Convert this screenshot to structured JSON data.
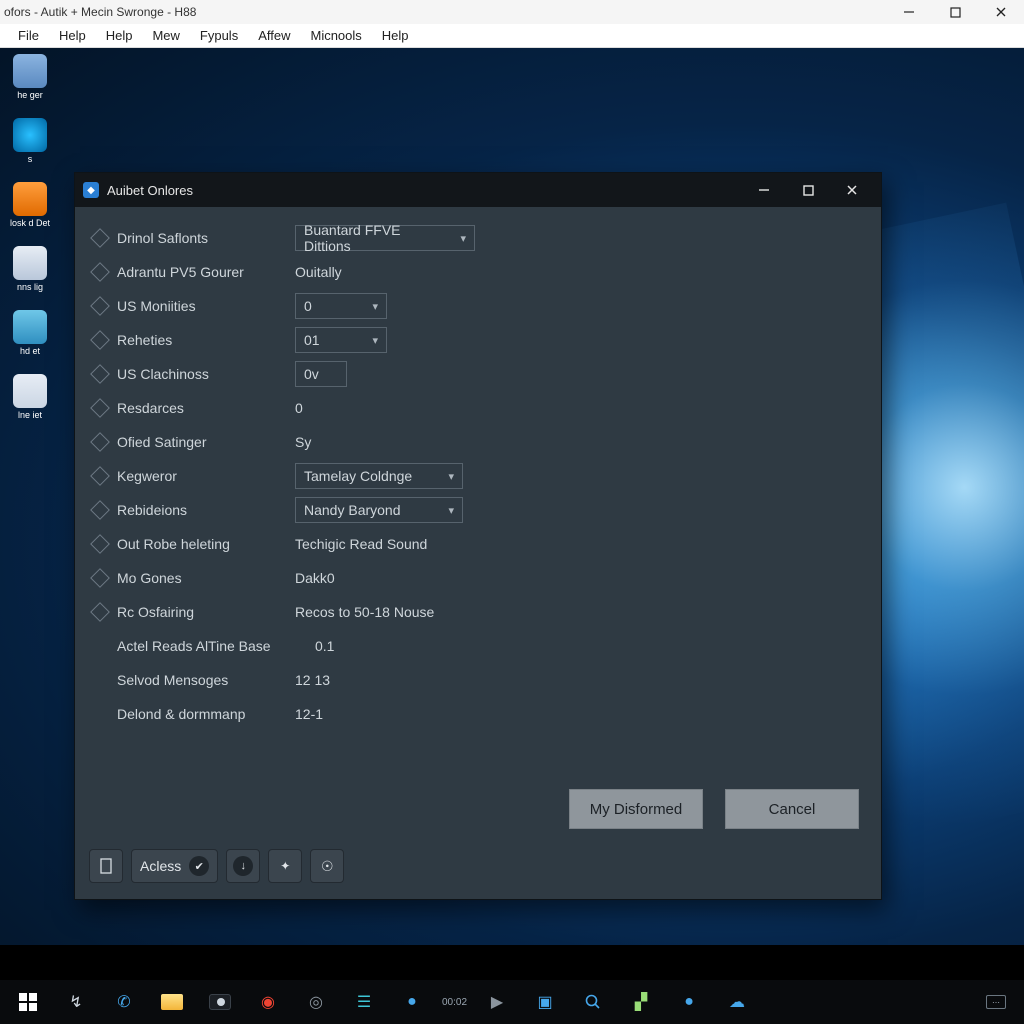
{
  "app": {
    "title": "ofors - Autik + Mecin Swronge - H88"
  },
  "menubar": [
    "File",
    "Help",
    "Help",
    "Mew",
    "Fypuls",
    "Affew",
    "Micnools",
    "Help"
  ],
  "desktop_icons": [
    {
      "label": "he\nger"
    },
    {
      "label": "s"
    },
    {
      "label": "losk\nd Det"
    },
    {
      "label": "nns\nlig"
    },
    {
      "label": "hd\net"
    },
    {
      "label": "lne\niet"
    }
  ],
  "dialog": {
    "title": "Auibet Onlores",
    "rows": {
      "r0": {
        "label": "Drinol Saflonts",
        "value": "Buantard FFVE Dittions"
      },
      "r1": {
        "label": "Adrantu PV5 Gourer",
        "value": "Ouitally"
      },
      "r2": {
        "label": "US Moniities",
        "value": "0"
      },
      "r3": {
        "label": "Reheties",
        "value": "01"
      },
      "r4": {
        "label": "US Clachinoss",
        "value": "0v"
      },
      "r5": {
        "label": "Resdarces",
        "value": "0"
      },
      "r6": {
        "label": "Ofied Satinger",
        "value": "Sy"
      },
      "r7": {
        "label": "Kegweror",
        "value": "Tamelay Coldnge"
      },
      "r8": {
        "label": "Rebideions",
        "value": "Nandy Baryond"
      },
      "r9": {
        "label": "Out Robe heleting",
        "value": "Techigic Read Sound"
      },
      "r10": {
        "label": "Mo Gones",
        "value": "Dakk0"
      },
      "r11": {
        "label": "Rc Osfairing",
        "value": "Recos to 50-18 Nouse"
      },
      "r12": {
        "label": "Actel Reads AlTine Base",
        "value": "0.1"
      },
      "r13": {
        "label": "Selvod Mensoges",
        "value": "12 13"
      },
      "r14": {
        "label": "Delond & dormmanp",
        "value": "12-1"
      }
    },
    "buttons": {
      "primary": "My Disformed",
      "cancel": "Cancel"
    },
    "toolbar": {
      "access": "Acless"
    }
  }
}
